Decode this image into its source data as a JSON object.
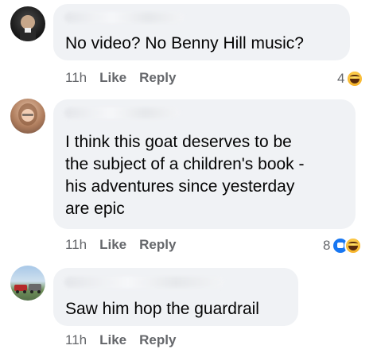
{
  "comments": [
    {
      "text_lines": [
        "No video? No Benny Hill music?"
      ],
      "time": "11h",
      "like_label": "Like",
      "reply_label": "Reply",
      "reaction_count": "4",
      "reactions": [
        "haha-icon"
      ]
    },
    {
      "text_lines": [
        "I think this goat deserves to be",
        "the subject of a children's book -",
        "his adventures since yesterday",
        "are epic"
      ],
      "time": "11h",
      "like_label": "Like",
      "reply_label": "Reply",
      "reaction_count": "8",
      "reactions": [
        "like-icon",
        "haha-icon"
      ]
    },
    {
      "text_lines": [
        "Saw him hop the guardrail"
      ],
      "time": "11h",
      "like_label": "Like",
      "reply_label": "Reply"
    }
  ],
  "colors": {
    "bubble": "#f0f2f5",
    "action_text": "#65676b",
    "like_blue": "#1877f2",
    "haha_yellow": "#f7b125"
  }
}
